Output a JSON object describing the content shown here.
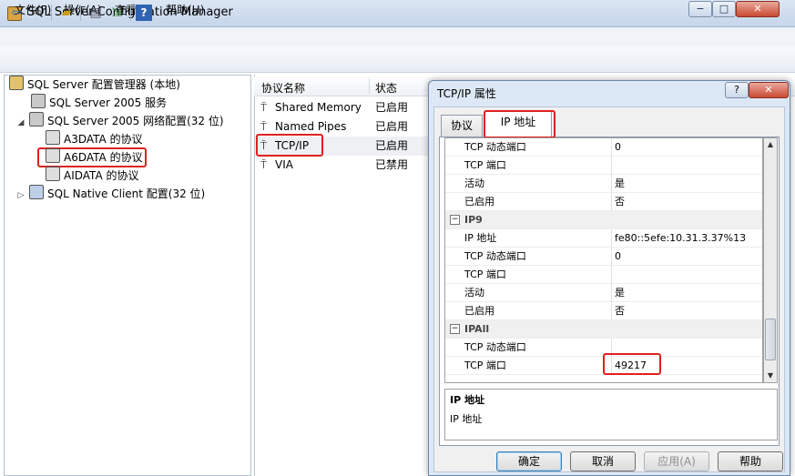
{
  "window": {
    "title": "SQL Server Configuration Manager"
  },
  "menu": [
    "文件(F)",
    "操作(A)",
    "查看(V)",
    "帮助(H)"
  ],
  "tree": {
    "root": "SQL Server 配置管理器 (本地)",
    "services": "SQL Server 2005 服务",
    "network": "SQL Server 2005 网络配置(32 位)",
    "instances": [
      "A3DATA 的协议",
      "A6DATA 的协议",
      "AIDATA 的协议"
    ],
    "native_client": "SQL Native Client 配置(32 位)"
  },
  "list": {
    "col_name": "协议名称",
    "col_status": "状态",
    "rows": [
      {
        "name": "Shared Memory",
        "status": "已启用"
      },
      {
        "name": "Named Pipes",
        "status": "已启用"
      },
      {
        "name": "TCP/IP",
        "status": "已启用"
      },
      {
        "name": "VIA",
        "status": "已禁用"
      }
    ]
  },
  "dialog": {
    "title": "TCP/IP 属性",
    "help_btn": "?",
    "tabs": [
      "协议",
      "IP 地址"
    ],
    "rows": [
      {
        "kind": "prop",
        "name": "TCP 动态端口",
        "value": "0"
      },
      {
        "kind": "prop",
        "name": "TCP 端口",
        "value": ""
      },
      {
        "kind": "prop",
        "name": "活动",
        "value": "是"
      },
      {
        "kind": "prop",
        "name": "已启用",
        "value": "否"
      },
      {
        "kind": "group",
        "name": "IP9",
        "toggle": "−"
      },
      {
        "kind": "prop",
        "name": "IP 地址",
        "value": "fe80::5efe:10.31.3.37%13"
      },
      {
        "kind": "prop",
        "name": "TCP 动态端口",
        "value": "0"
      },
      {
        "kind": "prop",
        "name": "TCP 端口",
        "value": ""
      },
      {
        "kind": "prop",
        "name": "活动",
        "value": "是"
      },
      {
        "kind": "prop",
        "name": "已启用",
        "value": "否"
      },
      {
        "kind": "group",
        "name": "IPAll",
        "toggle": "−"
      },
      {
        "kind": "prop",
        "name": "TCP 动态端口",
        "value": ""
      },
      {
        "kind": "prop",
        "name": "TCP 端口",
        "value": "49217"
      }
    ],
    "description": {
      "title": "IP 地址",
      "text": "IP 地址"
    },
    "buttons": {
      "ok": "确定",
      "cancel": "取消",
      "apply": "应用(A)",
      "help": "帮助"
    }
  },
  "window_buttons": {
    "min": "−",
    "max": "□",
    "close": "✕"
  },
  "toolbar_icons": [
    "back-icon",
    "forward-icon",
    "up-folder-icon",
    "properties-icon",
    "export-icon",
    "help-icon"
  ],
  "colors": {
    "highlight": "#e02020",
    "title_bar": "#c5d5ea",
    "dialog_frame": "#dce8f6"
  }
}
